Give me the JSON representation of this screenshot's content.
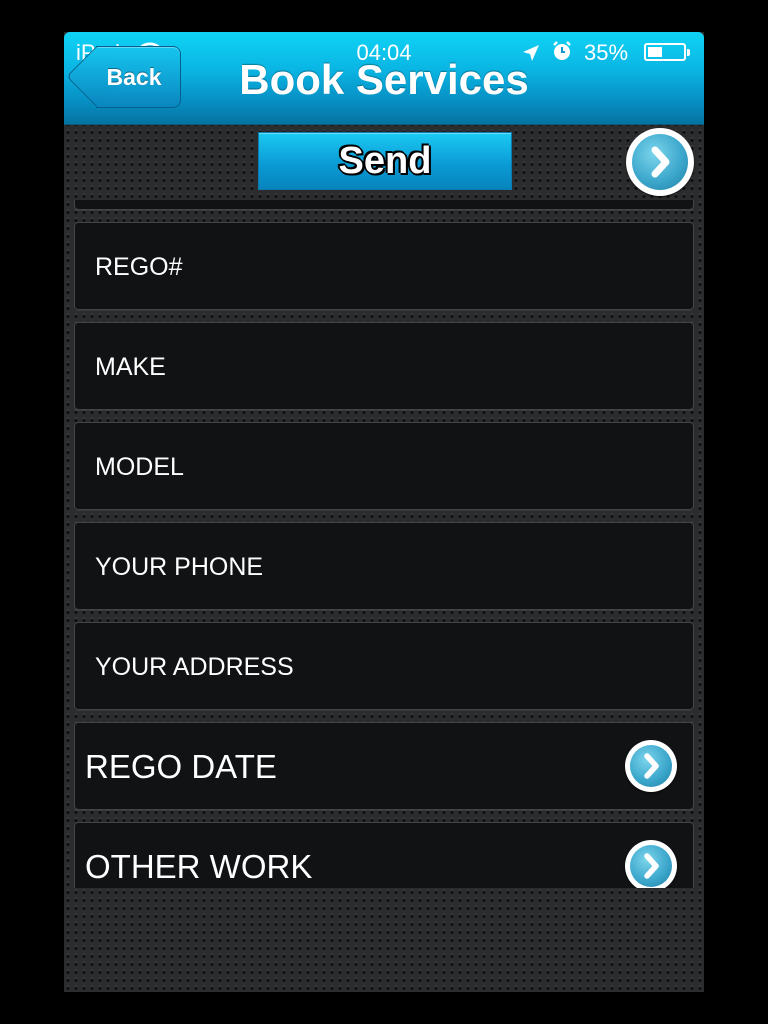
{
  "status_bar": {
    "carrier": "iPad",
    "time": "04:04",
    "battery_percent": "35%",
    "battery_level": 0.35,
    "icons": [
      "wifi-icon",
      "location-arrow-icon",
      "alarm-clock-icon",
      "battery-icon"
    ]
  },
  "navbar": {
    "back_label": "Back",
    "title": "Book Services"
  },
  "toolbar": {
    "send_label": "Send",
    "next_icon": "chevron-right-icon"
  },
  "form": {
    "fields": [
      {
        "label": "REGO#"
      },
      {
        "label": "MAKE"
      },
      {
        "label": "MODEL"
      },
      {
        "label": "YOUR PHONE"
      },
      {
        "label": "YOUR ADDRESS"
      }
    ],
    "disclosure_rows": [
      {
        "label": "REGO DATE"
      },
      {
        "label": "OTHER WORK"
      }
    ]
  },
  "colors": {
    "accent": "#0ab6e4",
    "cell_background": "#111214",
    "background": "#2b2c2e"
  }
}
